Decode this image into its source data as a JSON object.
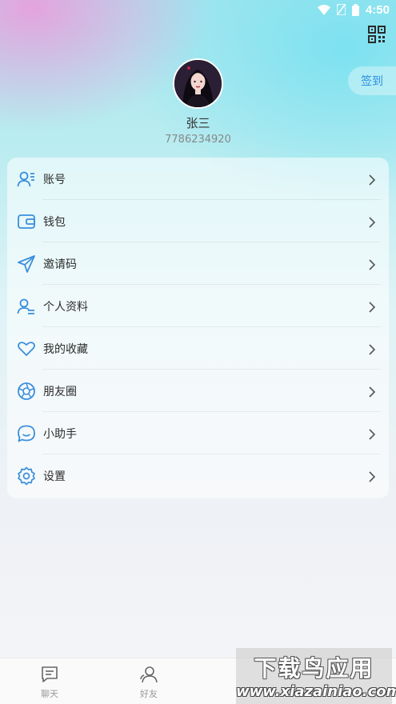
{
  "status_bar": {
    "time": "4:50",
    "icons": [
      "wifi-icon",
      "no-sim-icon",
      "battery-icon"
    ]
  },
  "header": {
    "qr_icon": "qr-code-icon",
    "sign_in_label": "签到",
    "username": "张三",
    "user_id": "7786234920"
  },
  "colors": {
    "accent": "#2f8fe0",
    "icon_blue": "#3a8fdc"
  },
  "menu": {
    "items": [
      {
        "label": "账号",
        "icon": "account-icon"
      },
      {
        "label": "钱包",
        "icon": "wallet-icon"
      },
      {
        "label": "邀请码",
        "icon": "paper-plane-icon"
      },
      {
        "label": "个人资料",
        "icon": "profile-icon"
      },
      {
        "label": "我的收藏",
        "icon": "heart-icon"
      },
      {
        "label": "朋友圈",
        "icon": "aperture-icon"
      },
      {
        "label": "小助手",
        "icon": "chat-bubble-icon"
      },
      {
        "label": "设置",
        "icon": "gear-icon"
      }
    ]
  },
  "tab_bar": {
    "tabs": [
      {
        "label": "聊天",
        "icon": "chat-icon"
      },
      {
        "label": "好友",
        "icon": "friends-icon"
      }
    ]
  },
  "watermark": {
    "title": "下载鸟应用",
    "url": "www.xiazainiao.com"
  }
}
